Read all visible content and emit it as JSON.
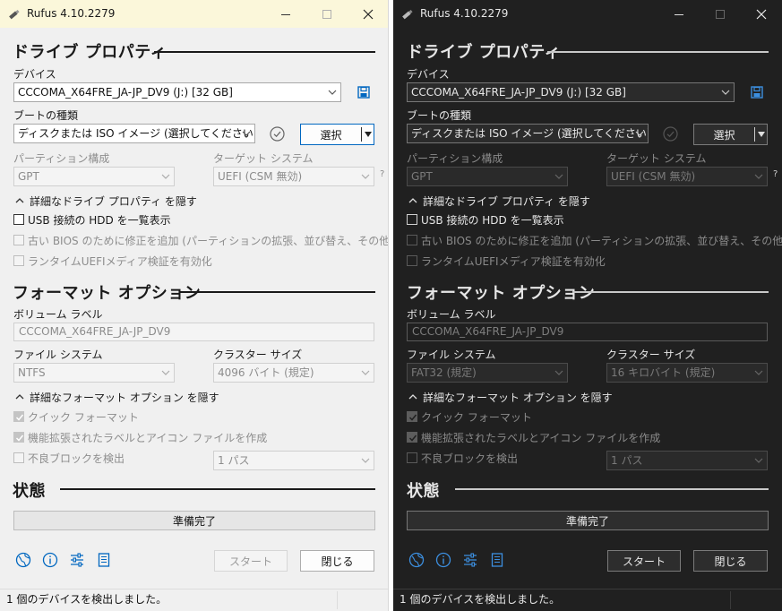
{
  "app": {
    "title": "Rufus 4.10.2279"
  },
  "sections": {
    "drive": "ドライブ プロパティ",
    "format": "フォーマット オプション",
    "status": "状態"
  },
  "labels": {
    "device": "デバイス",
    "boot_type": "ブートの種類",
    "partition": "パーティション構成",
    "target": "ターゲット システム",
    "volume": "ボリューム ラベル",
    "filesystem": "ファイル システム",
    "cluster": "クラスター サイズ",
    "help_mark": "?"
  },
  "buttons": {
    "select": "選択",
    "start": "スタート",
    "close": "閉じる"
  },
  "drive_options": {
    "toggle": "詳細なドライブ プロパティ を隠す",
    "usb_hdd": "USB 接続の HDD を一覧表示",
    "bios_fix": "古い BIOS のために修正を追加 (パーティションの拡張、並び替え、その他)",
    "uefi_check": "ランタイムUEFIメディア検証を有効化"
  },
  "format_options": {
    "toggle": "詳細なフォーマット オプション を隠す",
    "quick": "クイック フォーマット",
    "extended_label": "機能拡張されたラベルとアイコン ファイルを作成",
    "bad_blocks": "不良ブロックを検出"
  },
  "light": {
    "device": "CCCOMA_X64FRE_JA-JP_DV9 (J:) [32 GB]",
    "boot": "ディスクまたは ISO イメージ (選択してください)",
    "partition": "GPT",
    "target": "UEFI (CSM 無効)",
    "volume": "CCCOMA_X64FRE_JA-JP_DV9",
    "filesystem": "NTFS",
    "cluster": "4096 バイト (規定)",
    "passes": "1 パス",
    "status": "準備完了",
    "footer": "1 個のデバイスを検出しました。"
  },
  "dark": {
    "device": "CCCOMA_X64FRE_JA-JP_DV9 (J:) [32 GB]",
    "boot": "ディスクまたは ISO イメージ (選択してください)",
    "partition": "GPT",
    "target": "UEFI (CSM 無効)",
    "volume": "CCCOMA_X64FRE_JA-JP_DV9",
    "filesystem": "FAT32 (規定)",
    "cluster": "16 キロバイト (規定)",
    "passes": "1 パス",
    "status": "準備完了",
    "footer": "1 個のデバイスを検出しました。"
  },
  "colors": {
    "accent": "#0067c0",
    "light_titlebar": "#fbf7da",
    "dark_bg": "#202020"
  }
}
